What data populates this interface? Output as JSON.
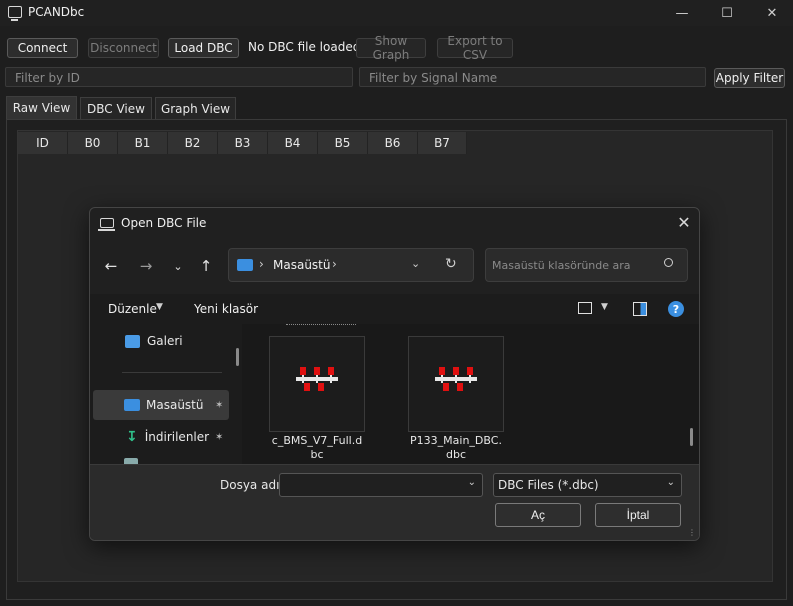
{
  "window": {
    "title": "PCANDbc"
  },
  "toolbar": {
    "connect": "Connect",
    "disconnect": "Disconnect",
    "load_dbc": "Load DBC",
    "status": "No DBC file loaded",
    "show_graph": "Show Graph",
    "export_csv": "Export to CSV"
  },
  "filters": {
    "id_placeholder": "Filter by ID",
    "signal_placeholder": "Filter by Signal Name",
    "apply": "Apply Filter"
  },
  "tabs": [
    {
      "label": "Raw View"
    },
    {
      "label": "DBC View"
    },
    {
      "label": "Graph View"
    }
  ],
  "table": {
    "columns": [
      "ID",
      "B0",
      "B1",
      "B2",
      "B3",
      "B4",
      "B5",
      "B6",
      "B7"
    ]
  },
  "dialog": {
    "title": "Open DBC File",
    "address": {
      "location": "Masaüstü"
    },
    "search_placeholder": "Masaüstü klasöründe ara",
    "commands": {
      "organize": "Düzenle",
      "new_folder": "Yeni klasör"
    },
    "nav_items": [
      {
        "label": "Galeri"
      },
      {
        "label": "Masaüstü"
      },
      {
        "label": "İndirilenler"
      }
    ],
    "files": [
      {
        "name_line1": "c_BMS_V7_Full.d",
        "name_line2": "bc"
      },
      {
        "name_line1": "P133_Main_DBC.",
        "name_line2": "dbc"
      }
    ],
    "filename_label": "Dosya adı:",
    "filename_value": "",
    "filetype": "DBC Files (*.dbc)",
    "open_button": "Aç",
    "cancel_button": "İptal"
  },
  "colors": {
    "accent": "#3b8fe0",
    "file_icon_red": "#e01010"
  }
}
